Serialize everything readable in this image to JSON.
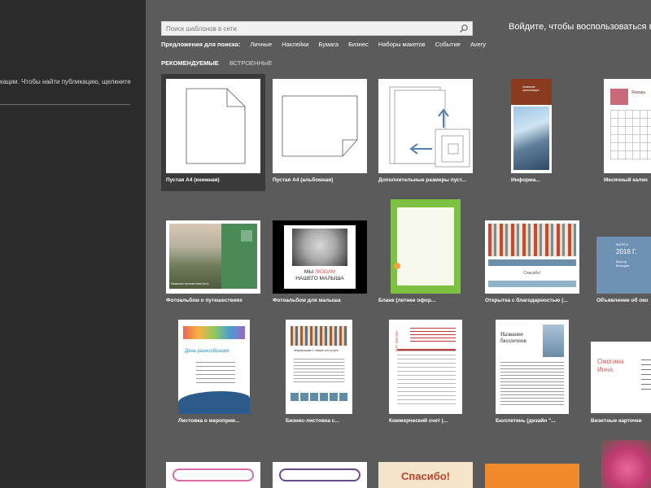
{
  "left_panel": {
    "hint": "кации. Чтобы найти публикацию, щелкните"
  },
  "search": {
    "placeholder": "Поиск шаблонов в сети",
    "icon": "search-icon"
  },
  "suggestions": {
    "label": "Предложения для поиска:",
    "items": [
      "Личные",
      "Наклейки",
      "Бумага",
      "Бизнес",
      "Наборы макетов",
      "Событие",
      "Avery"
    ]
  },
  "signin": "Войдите, чтобы воспользоваться в",
  "tabs": [
    {
      "label": "РЕКОМЕНДУЕМЫЕ",
      "active": true
    },
    {
      "label": "ВСТРОЕННЫЕ",
      "active": false
    }
  ],
  "templates": [
    {
      "caption": "Пустая A4 (книжная)"
    },
    {
      "caption": "Пустая A4 (альбомная)"
    },
    {
      "caption": "Дополнительные размеры пуст..."
    },
    {
      "caption": "Информа...",
      "thumb_text": "Название организации"
    },
    {
      "caption": "Месячный кален",
      "thumb_text": "Январь"
    },
    {
      "caption": "Фотоальбом о путешествиях",
      "thumb_text": "Название путешествия (Кто)"
    },
    {
      "caption": "Фотоальбом для малыша",
      "thumb_line1": "МЫ",
      "thumb_red": "ЛЮБИМ",
      "thumb_line2": "НАШЕГО МАЛЫША"
    },
    {
      "caption": "Бланк (летнее офор..."
    },
    {
      "caption": "Открытка с благодарностью (...",
      "thumb_text": "Спасибо!"
    },
    {
      "caption": "Объявление об око",
      "thumb_line1": "ВЫПУСК",
      "thumb_year": "2016 Г.",
      "thumb_line2": "Виктор Володин"
    },
    {
      "caption": "Листовка о мероприя...",
      "thumb_text": "День разнообразия"
    },
    {
      "caption": "Бизнес-листовка с...",
      "thumb_text": "Информация о товаре или услуге"
    },
    {
      "caption": "Коммерческий счет (...",
      "thumb_text": "Счет-фактура"
    },
    {
      "caption": "Бюллетень (дизайн \"...",
      "thumb_text": "Название бюллетеня"
    },
    {
      "caption": "Визитные карточки",
      "thumb_text": "Ожогина Инна"
    },
    {
      "caption": "",
      "thumb_text": "Спасибо!"
    }
  ],
  "colors": {
    "left_panel": "#2b2b2b",
    "background": "#5b5b5b",
    "accent_red": "#d9534f"
  }
}
